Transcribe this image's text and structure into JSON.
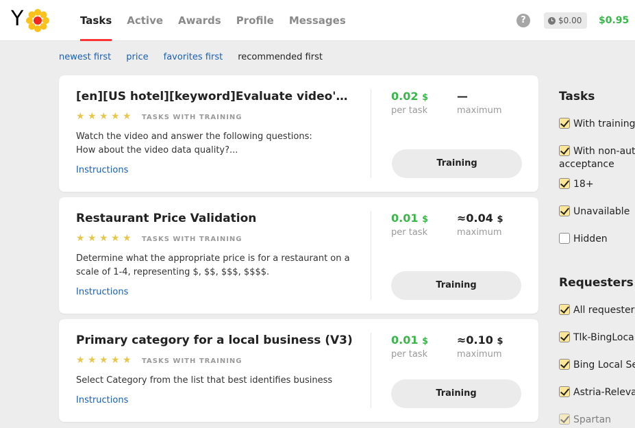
{
  "header": {
    "logo_text": "Y",
    "nav": [
      "Tasks",
      "Active",
      "Awards",
      "Profile",
      "Messages"
    ],
    "help": "?",
    "pending_balance": "$0.00",
    "balance": "$0.95"
  },
  "sort": {
    "options": [
      "newest first",
      "price",
      "favorites first"
    ],
    "current": "recommended first"
  },
  "cards": [
    {
      "title": "[en][US hotel][keyword]Evaluate video's dat...",
      "tag": "TASKS WITH TRAINING",
      "rating": 5,
      "desc": [
        "Watch the video and answer the following questions:",
        "How about the video data quality?..."
      ],
      "instructions": "Instructions",
      "price": "0.02",
      "price_cur": "$",
      "price_label": "per task",
      "max": "—",
      "max_cur": "",
      "max_label": "maximum",
      "button": "Training"
    },
    {
      "title": "Restaurant Price Validation",
      "tag": "TASKS WITH TRAINING",
      "rating": 5,
      "desc": [
        "Determine what the appropriate price is for a restaurant on a",
        "scale of 1-4, representing $, $$, $$$, $$$$."
      ],
      "instructions": "Instructions",
      "price": "0.01",
      "price_cur": "$",
      "price_label": "per task",
      "max": "≈0.04",
      "max_cur": "$",
      "max_label": "maximum",
      "button": "Training"
    },
    {
      "title": "Primary category for a local business (V3)",
      "tag": "TASKS WITH TRAINING",
      "rating": 5,
      "desc": [
        "Select Category from the list that best identifies business",
        ""
      ],
      "instructions": "Instructions",
      "price": "0.01",
      "price_cur": "$",
      "price_label": "per task",
      "max": "≈0.10",
      "max_cur": "$",
      "max_label": "maximum",
      "button": "Training"
    }
  ],
  "sidebar": {
    "tasks_heading": "Tasks",
    "tasks_filters": [
      {
        "label": "With training",
        "checked": true
      },
      {
        "label": "With non-auto",
        "checked": true
      },
      {
        "label": "acceptance",
        "checked": null
      },
      {
        "label": "18+",
        "checked": true
      },
      {
        "label": "Unavailable",
        "checked": true
      },
      {
        "label": "Hidden",
        "checked": false
      }
    ],
    "requesters_heading": "Requesters",
    "requesters": [
      {
        "label": "All requesters",
        "checked": true
      },
      {
        "label": "Tlk-BingLocal",
        "checked": true
      },
      {
        "label": "Bing Local Se",
        "checked": true
      },
      {
        "label": "Astria-Releva",
        "checked": true
      },
      {
        "label": "Spartan",
        "checked": true
      }
    ]
  },
  "colors": {
    "accent_red": "#ff3333",
    "money_green": "#3ab64a",
    "link_blue": "#1a5fb4",
    "star_gold": "#e5c74c",
    "checkbox_yellow": "#fde698"
  }
}
